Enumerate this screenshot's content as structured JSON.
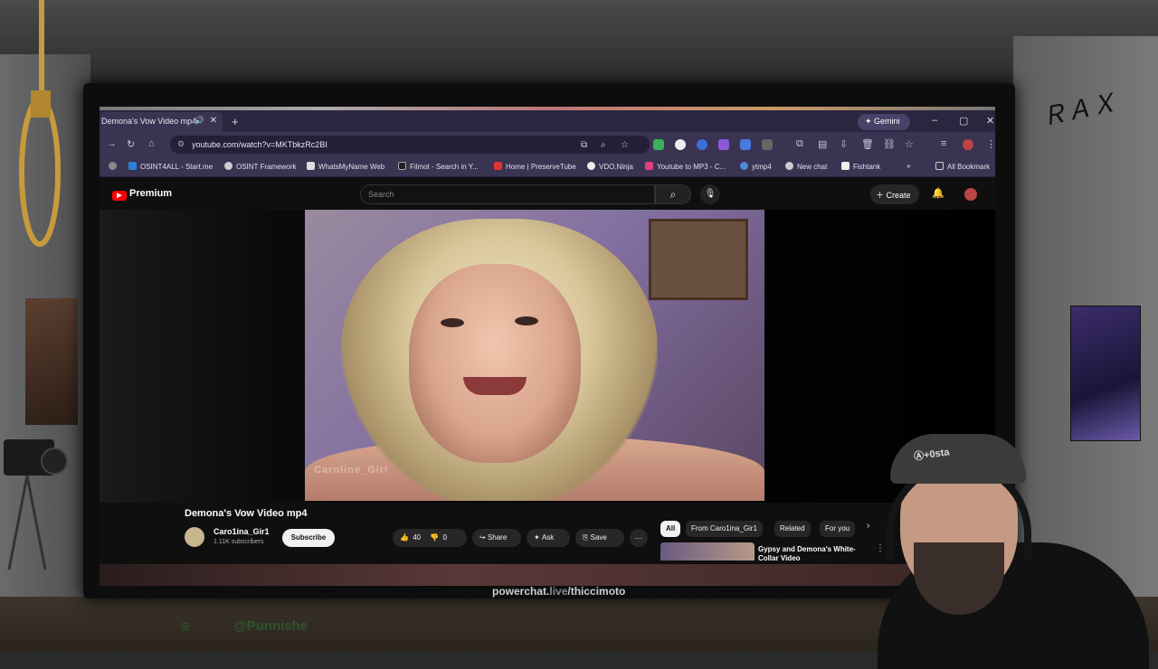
{
  "browser": {
    "tab_title": "Demona's Vow Video mp4",
    "gemini_label": "Gemini",
    "url": "youtube.com/watch?v=MKTbkzRc2BI",
    "bookmarks": [
      "OSINT4ALL - Start.me",
      "OSINT Framework",
      "WhatsMyName Web",
      "Filmot - Search in Y...",
      "Home | PreserveTube",
      "VDO.Ninja",
      "Youtube to MP3 - C...",
      "ytmp4",
      "New chat",
      "Fishtank"
    ],
    "all_bookmarks": "All Bookmark"
  },
  "youtube": {
    "logo": "Premium",
    "search_placeholder": "Search",
    "create_label": "Create",
    "watermark": "Caroline_Girl",
    "video_title": "Demona's Vow Video mp4",
    "channel_name": "Caro1ina_Gir1",
    "subscribers": "1.11K subscribers",
    "subscribe_label": "Subscribe",
    "likes": "40",
    "dislikes": "0",
    "share_label": "Share",
    "ask_label": "Ask",
    "save_label": "Save",
    "chips": [
      "All",
      "From Caro1ina_Gir1",
      "Related",
      "For you"
    ],
    "recommendation_title": "Gypsy and Demona's White-Collar Video"
  },
  "overlay": {
    "powerchat_prefix": "powerchat.",
    "powerchat_mid": "live",
    "powerchat_suffix": "/thiccimoto",
    "handle": "@Punnishe",
    "cap_text": "Ⓐ+0sta"
  },
  "colors": {
    "youtube_red": "#ff0000",
    "browser_chrome": "#3a3352"
  }
}
